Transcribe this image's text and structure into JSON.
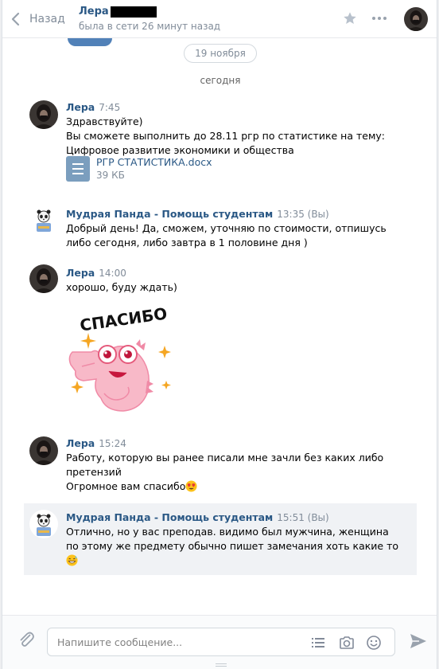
{
  "header": {
    "back_label": "Назад",
    "peer_name": "Лера",
    "peer_status": "была в сети 26 минут назад"
  },
  "history": {
    "date_divider": "19 ноября",
    "today_divider": "сегодня"
  },
  "messages": [
    {
      "author": "Лера",
      "time": "7:45",
      "lines": [
        "Здравствуйте)",
        "Вы сможете выполнить до 28.11 ргр по статистике на тему:",
        "Цифровое развитие экономики и общества"
      ],
      "attachment": {
        "name": "РГР СТАТИСТИКА.docx",
        "size": "39 КБ"
      }
    },
    {
      "author": "Мудрая Панда - Помощь студентам",
      "time": "13:35 (Вы)",
      "lines": [
        "Добрый день! Да, сможем, уточняю по стоимости, отпишусь",
        "либо сегодня, либо завтра в 1 половине дня )"
      ]
    },
    {
      "author": "Лера",
      "time": "14:00",
      "lines": [
        "хорошо, буду ждать)"
      ],
      "sticker_text": "СПАСИБО"
    },
    {
      "author": "Лера",
      "time": "15:24",
      "lines": [
        "Работу, которую вы ранее писали мне зачли без каких либо",
        "претензий",
        "Огромное вам спасибо"
      ]
    },
    {
      "author": "Мудрая Панда - Помощь студентам",
      "time": "15:51 (Вы)",
      "lines": [
        "Отлично, но у вас преподав. видимо был мужчина, женщина",
        "по этому же предмету обычно пишет замечания хоть какие то"
      ]
    }
  ],
  "composer": {
    "placeholder": "Напишите сообщение..."
  },
  "colors": {
    "link": "#2a5885",
    "muted": "#818c99",
    "highlight_bg": "#f0f2f5",
    "accent": "#5181b8"
  },
  "icons": [
    "chevron-left-icon",
    "star-icon",
    "more-icon",
    "document-icon",
    "paperclip-icon",
    "list-icon",
    "camera-icon",
    "smile-icon",
    "send-icon",
    "heart-eyes-emoji",
    "grinning-sweat-emoji"
  ]
}
